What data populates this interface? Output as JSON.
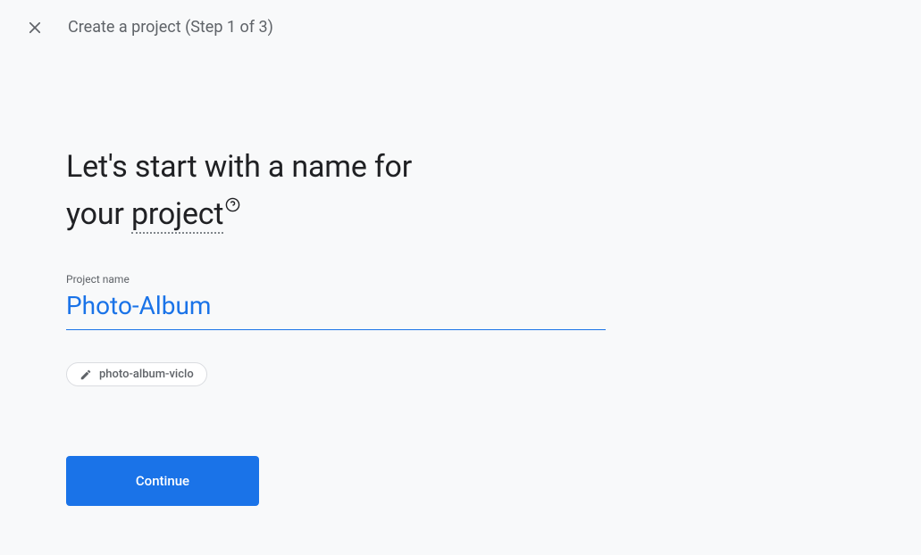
{
  "header": {
    "title": "Create a project (Step 1 of 3)"
  },
  "heading": {
    "line1": "Let's start with a name for",
    "line2_prefix": "your ",
    "line2_underlined": "project"
  },
  "field": {
    "label": "Project name",
    "value": "Photo-Album"
  },
  "chip": {
    "label": "photo-album-viclo"
  },
  "cta": {
    "continue": "Continue"
  }
}
